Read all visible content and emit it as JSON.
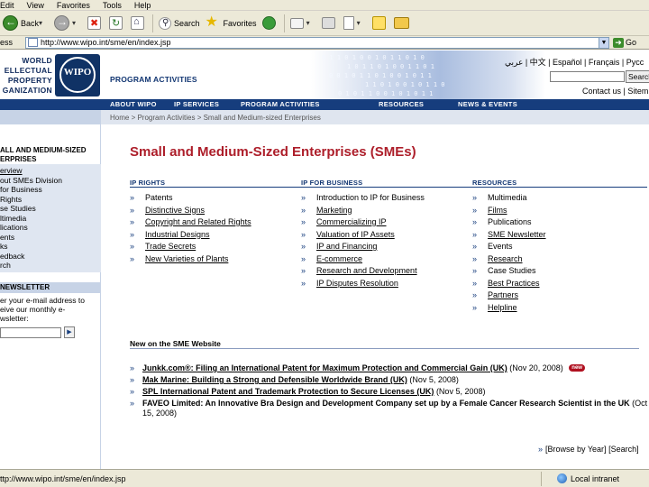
{
  "browser": {
    "menu": [
      "Edit",
      "View",
      "Favorites",
      "Tools",
      "Help"
    ],
    "toolbar": {
      "back": "Back",
      "search": "Search",
      "favorites": "Favorites"
    },
    "address": {
      "label": "ess",
      "url": "http://www.wipo.int/sme/en/index.jsp",
      "go": "Go"
    },
    "status": {
      "text": "ttp://www.wipo.int/sme/en/index.jsp",
      "zone": "Local intranet"
    }
  },
  "site": {
    "logo_lines": [
      "WORLD",
      "ELLECTUAL",
      "PROPERTY",
      "GANIZATION"
    ],
    "logo_letters": "WIPO",
    "section_label": "PROGRAM ACTIVITIES",
    "languages": "عربي | 中文 | Español | Français | Pycc",
    "search_button": "Search",
    "top_links": "Contact us  |  Sitem",
    "nav": [
      "ABOUT WIPO",
      "IP SERVICES",
      "PROGRAM ACTIVITIES",
      "RESOURCES",
      "NEWS & EVENTS"
    ],
    "breadcrumb": "Home > Program Activities > Small and Medium-sized Enterprises"
  },
  "sidebar": {
    "title_lines": [
      "ALL AND MEDIUM-SIZED",
      "ERPRISES"
    ],
    "items": [
      "erview",
      "out SMEs Division",
      "for Business",
      "Rights",
      "se Studies",
      "ltimedia",
      "lications",
      "ents",
      "ks",
      "edback",
      "rch"
    ],
    "newsletter": {
      "title": "NEWSLETTER",
      "text_lines": [
        "er your e-mail address to",
        "eive our monthly e-",
        "wsletter:"
      ]
    }
  },
  "main": {
    "title": "Small and Medium-Sized Enterprises (SMEs)",
    "columns": [
      {
        "heading": "IP RIGHTS",
        "items": [
          {
            "label": "Patents",
            "link": false
          },
          {
            "label": "Distinctive Signs",
            "link": true
          },
          {
            "label": "Copyright and Related Rights",
            "link": true
          },
          {
            "label": "Industrial Designs",
            "link": true
          },
          {
            "label": "Trade Secrets",
            "link": true
          },
          {
            "label": "New Varieties of Plants",
            "link": true
          }
        ]
      },
      {
        "heading": "IP FOR BUSINESS",
        "items": [
          {
            "label": "Introduction to IP for Business",
            "link": false
          },
          {
            "label": "Marketing",
            "link": true
          },
          {
            "label": "Commercializing IP",
            "link": true
          },
          {
            "label": "Valuation of IP Assets",
            "link": true
          },
          {
            "label": "IP and Financing",
            "link": true
          },
          {
            "label": "E-commerce",
            "link": true
          },
          {
            "label": "Research and Development",
            "link": true
          },
          {
            "label": "IP Disputes Resolution",
            "link": true
          }
        ]
      },
      {
        "heading": "RESOURCES",
        "items": [
          {
            "label": "Multimedia",
            "link": false
          },
          {
            "label": "Films",
            "link": true
          },
          {
            "label": "Publications",
            "link": false
          },
          {
            "label": "SME Newsletter",
            "link": true
          },
          {
            "label": "Events",
            "link": false
          },
          {
            "label": "Research",
            "link": true
          },
          {
            "label": "Case Studies",
            "link": false
          },
          {
            "label": "Best Practices",
            "link": true
          },
          {
            "label": "Partners",
            "link": true
          },
          {
            "label": "Helpline",
            "link": true
          }
        ]
      }
    ],
    "new_heading": "New on the SME Website",
    "news": [
      {
        "title": "Junkk.com®: Filing an International Patent for Maximum Protection and Commercial Gain (UK)",
        "date": "(Nov 20, 2008)",
        "badge": "new",
        "link": true
      },
      {
        "title": "Mak Marine: Building a Strong and Defensible Worldwide Brand (UK)",
        "date": "(Nov 5, 2008)",
        "badge": "",
        "link": true
      },
      {
        "title": "SPL International Patent and Trademark Protection to Secure Licenses (UK)",
        "date": "(Nov 5, 2008)",
        "badge": "",
        "link": true
      },
      {
        "title": "FAVEO Limited: An Innovative Bra Design and Development Company set up by a Female Cancer Research Scientist in the UK",
        "date": "(Oct 15, 2008)",
        "badge": "",
        "link": false
      }
    ],
    "browse_label": "[Browse by Year]",
    "search_label": "[Search]"
  }
}
